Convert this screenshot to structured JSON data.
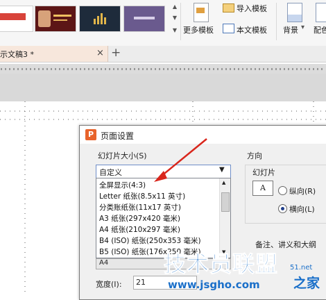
{
  "ribbon": {
    "more_templates": "更多模板",
    "import_template": "导入模板",
    "text_template": "本文模板",
    "background": "背景",
    "background_dropdown": "▾",
    "color_scheme": "配色"
  },
  "tabs": {
    "doc_title": "示文稿3 *",
    "close_glyph": "×",
    "new_tab_glyph": "+"
  },
  "dialog": {
    "title": "页面设置",
    "slide_size_label": "幻灯片大小(S)",
    "selected": "自定义",
    "options": [
      "全屏显示(4:3)",
      "Letter 纸张(8.5x11 英寸)",
      "分类账纸张(11x17 英寸)",
      "A3 纸张(297x420 毫米)",
      "A4 纸张(210x297 毫米)",
      "B4 (ISO) 纸张(250x353 毫米)",
      "B5 (ISO) 纸张(176x250 毫米)"
    ],
    "below_value": "A4",
    "width_label": "宽度(I):",
    "width_value": "21",
    "orientation_label": "方向",
    "slide_label": "幻灯片",
    "portrait": "纵向(R)",
    "landscape": "横向(L)",
    "notes_label": "备注、讲义和大纲"
  },
  "watermark": {
    "line1": "技术员联盟",
    "line2": "www.jsgho.com",
    "suffix": "之家",
    "fragment": "51.net"
  },
  "colors": {
    "annotation_arrow": "#d9261c",
    "dialog_icon": "#e8632b",
    "watermark_blue": "#1a6fc9",
    "tab_bg": "#f7e7dc"
  }
}
